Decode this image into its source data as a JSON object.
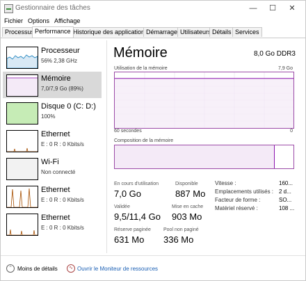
{
  "app": {
    "title": "Gestionnaire des tâches"
  },
  "window_controls": {
    "minimize": "—",
    "maximize": "☐",
    "close": "✕"
  },
  "menu": [
    "Fichier",
    "Options",
    "Affichage"
  ],
  "tabs": [
    "Processus",
    "Performance",
    "Historique des applications",
    "Démarrage",
    "Utilisateurs",
    "Détails",
    "Services"
  ],
  "active_tab": "Performance",
  "sidebar": {
    "items": [
      {
        "name": "Processeur",
        "detail": "56% 2,38 GHz",
        "color": "#117dbb",
        "fill": "#f1f6fa",
        "level": 0.56
      },
      {
        "name": "Mémoire",
        "detail": "7,0/7,9 Go (89%)",
        "color": "#8b12ae",
        "fill": "#fff",
        "level": 0.89
      },
      {
        "name": "Disque 0 (C: D:)",
        "detail": "100%",
        "color": "#4da60c",
        "fill": "#c6ecb6",
        "level": 1.0
      },
      {
        "name": "Ethernet",
        "detail": "E : 0 R : 0 Kbits/s",
        "color": "#a74f01",
        "fill": "#fff",
        "level": 0.1
      },
      {
        "name": "Wi-Fi",
        "detail": "Non connecté",
        "color": "#c8c8c8",
        "fill": "#f2f2f2",
        "level": 0.0
      },
      {
        "name": "Ethernet",
        "detail": "E : 0 R : 0 Kbits/s",
        "color": "#a74f01",
        "fill": "#fff",
        "level": 0.9
      },
      {
        "name": "Ethernet",
        "detail": "E : 0 R : 0 Kbits/s",
        "color": "#a74f01",
        "fill": "#fff",
        "level": 0.2
      }
    ]
  },
  "main": {
    "title": "Mémoire",
    "capacity": "8,0 Go DDR3",
    "usage_label": "Utilisation de la mémoire",
    "usage_max": "7,9 Go",
    "time_label": "60 secondes",
    "usage_level": 0.89,
    "composition_label": "Composition de la mémoire",
    "composition_in_use": 0.89,
    "color": "#8b12ae"
  },
  "stats": {
    "in_use_label": "En cours d'utilisation",
    "in_use": "7,0 Go",
    "available_label": "Disponible",
    "available": "887 Mo",
    "committed_label": "Validée",
    "committed": "9,5/11,4 Go",
    "cached_label": "Mise en cache",
    "cached": "903 Mo",
    "paged_label": "Réserve paginée",
    "paged": "631 Mo",
    "nonpaged_label": "Pool non paginé",
    "nonpaged": "336 Mo"
  },
  "details": [
    {
      "label": "Vitesse :",
      "value": "160..."
    },
    {
      "label": "Emplacements utilisés :",
      "value": "2 d..."
    },
    {
      "label": "Facteur de forme :",
      "value": "SO..."
    },
    {
      "label": "Matériel réservé :",
      "value": "108 ..."
    }
  ],
  "footer": {
    "less_details": "Moins de détails",
    "monitor": "Ouvrir le Moniteur de ressources"
  }
}
